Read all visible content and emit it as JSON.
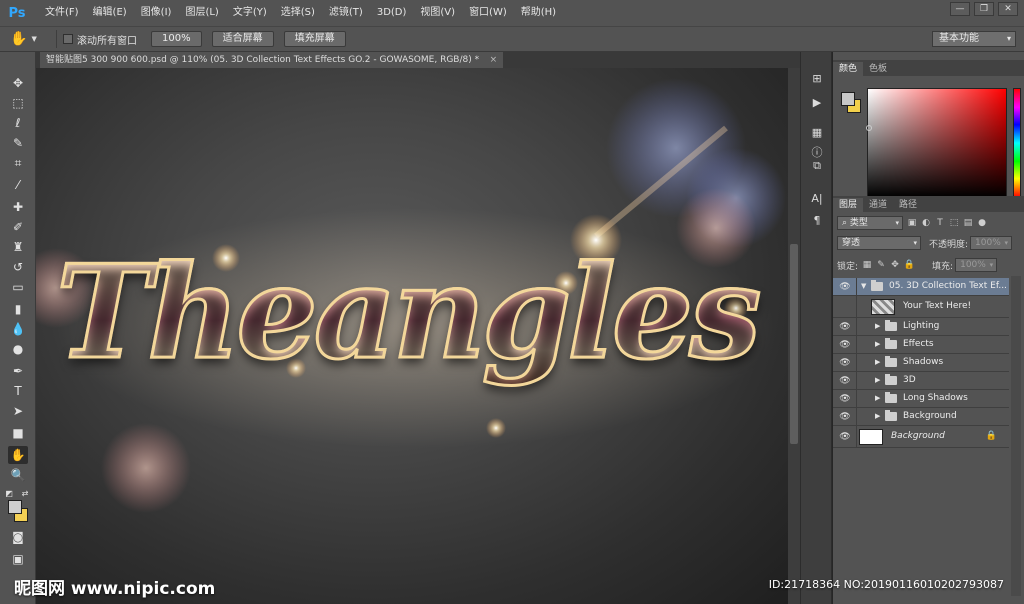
{
  "app": {
    "logo": "Ps"
  },
  "menu": [
    "文件(F)",
    "编辑(E)",
    "图像(I)",
    "图层(L)",
    "文字(Y)",
    "选择(S)",
    "滤镜(T)",
    "3D(D)",
    "视图(V)",
    "窗口(W)",
    "帮助(H)"
  ],
  "window_controls": {
    "minimize": "—",
    "restore": "❐",
    "close": "✕"
  },
  "options": {
    "scroll_all_label": "滚动所有窗口",
    "zoom_100": "100%",
    "fit_screen": "适合屏幕",
    "fill_screen": "填充屏幕",
    "workspace": "基本功能"
  },
  "document": {
    "tab_title": "智能贴图5 300 900 600.psd @ 110% (05. 3D Collection Text Effects GO.2 - GOWASOME, RGB/8) *",
    "close": "×",
    "artwork_text": "Theangles"
  },
  "color_panel": {
    "tabs": [
      "颜色",
      "色板"
    ],
    "fg_color": "#c8c8c8",
    "bg_color": "#f2d04b"
  },
  "layers_panel": {
    "tabs": [
      "图层",
      "通道",
      "路径"
    ],
    "filter_kind": "类型",
    "blend_mode": "穿透",
    "opacity_label": "不透明度:",
    "opacity_value": "100%",
    "lock_label": "锁定:",
    "fill_label": "填充:",
    "fill_value": "100%",
    "layers": [
      {
        "name": "05. 3D Collection Text Ef...",
        "type": "group",
        "expanded": true,
        "selected": true
      },
      {
        "name": "Your Text Here!",
        "type": "smart-object"
      },
      {
        "name": "Lighting",
        "type": "group"
      },
      {
        "name": "Effects",
        "type": "group"
      },
      {
        "name": "Shadows",
        "type": "group"
      },
      {
        "name": "3D",
        "type": "group"
      },
      {
        "name": "Long Shadows",
        "type": "group"
      },
      {
        "name": "Background",
        "type": "group"
      },
      {
        "name": "Background",
        "type": "background",
        "locked": true
      }
    ]
  },
  "watermark": {
    "left": "昵图网 www.nipic.com",
    "right": "ID:21718364 NO:20190116010202793087"
  }
}
